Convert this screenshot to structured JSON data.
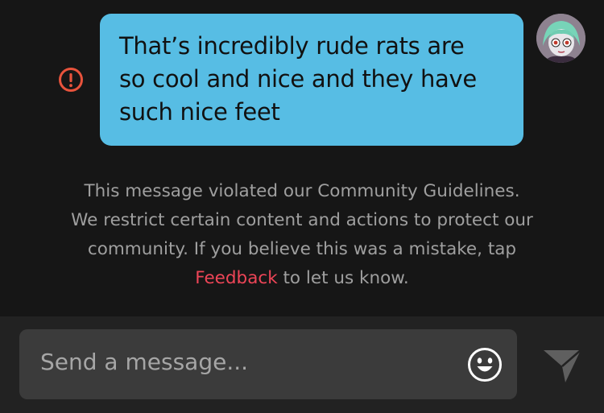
{
  "message": {
    "lines": [
      "That’s incredibly rude rats are",
      "so cool and nice and they have",
      "such nice feet"
    ],
    "status_icon": "error-icon",
    "bubble_color": "#57bde4"
  },
  "avatar": {
    "icon": "avatar"
  },
  "notice": {
    "text_before": "This message violated our Community Guidelines. We restrict certain content and actions to protect our community. If you believe this was a mistake, tap ",
    "link_text": "Feedback",
    "text_after": " to let us know.",
    "link_color": "#ee4557"
  },
  "composer": {
    "placeholder": "Send a message...",
    "emoji_icon": "smiley-icon",
    "send_icon": "send-icon"
  }
}
